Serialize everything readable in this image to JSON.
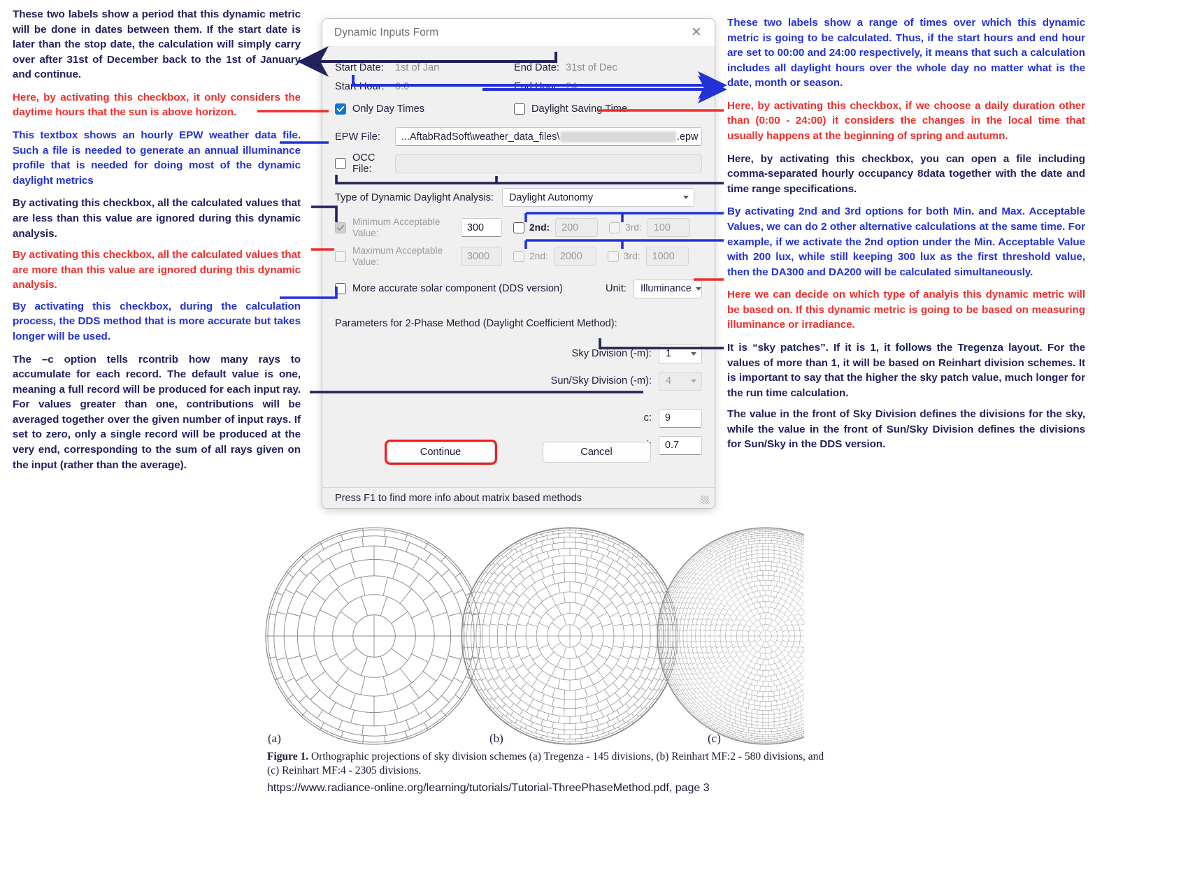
{
  "dialog": {
    "title": "Dynamic Inputs Form",
    "close_icon": "close-icon",
    "start_date_label": "Start Date:",
    "start_date_value": "1st of Jan",
    "end_date_label": "End Date:",
    "end_date_value": "31st of Dec",
    "start_hour_label": "Start Hour:",
    "start_hour_value": "0.0",
    "end_hour_label": "End Hour:",
    "end_hour_value": "24",
    "only_day_times_label": "Only Day Times",
    "daylight_saving_label": "Daylight Saving Time",
    "epw_label": "EPW File:",
    "epw_value_prefix": "...AftabRadSoft\\weather_data_files\\",
    "epw_value_redacted": "SWE_Stockholm_Arlanda",
    "epw_value_suffix": ".epw",
    "occ_label": "OCC File:",
    "occ_value": "",
    "analysis_type_label": "Type of Dynamic Daylight Analysis:",
    "analysis_type_value": "Daylight Autonomy",
    "min_acceptable_label": "Minimum Acceptable Value:",
    "min_value": "300",
    "min_2nd_label": "2nd:",
    "min_2nd_value": "200",
    "min_3rd_label": "3rd:",
    "min_3rd_value": "100",
    "max_acceptable_label": "Maximum Acceptable Value:",
    "max_value": "3000",
    "max_2nd_label": "2nd:",
    "max_2nd_value": "2000",
    "max_3rd_label": "3rd:",
    "max_3rd_value": "1000",
    "dds_label": "More accurate solar component (DDS version)",
    "unit_label": "Unit:",
    "unit_value": "Illuminance",
    "params_header": "Parameters for 2-Phase Method (Daylight Coefficient Method):",
    "sky_division_label": "Sky Division (-m):",
    "sky_division_value": "1",
    "sun_sky_division_label": "Sun/Sky Division (-m):",
    "sun_sky_division_value": "4",
    "c_label": "c:",
    "c_value": "9",
    "pj_label": "pj:",
    "pj_value": "0.7",
    "continue_label": "Continue",
    "cancel_label": "Cancel",
    "statusbar_text": "Press F1 to find more info about matrix based methods"
  },
  "annotations_left": [
    {
      "color": "dark",
      "text": "These two labels show a period that this dynamic metric will be done in dates between them. If the start date is later than the stop date, the calculation will simply carry over after 31st of December back to the 1st of January and continue."
    },
    {
      "color": "red",
      "text": "Here, by activating this checkbox, it only considers the daytime hours that the sun is above horizon."
    },
    {
      "color": "blue",
      "text": "This textbox shows an hourly EPW weather data file. Such a file is needed to generate an annual illuminance profile that is needed for doing most of the dynamic daylight metrics"
    },
    {
      "color": "dark",
      "text": "By activating this checkbox, all the calculated values that are less than this value are ignored during this dynamic analysis."
    },
    {
      "color": "red",
      "text": "By activating this checkbox, all the calculated values that are more than this value are ignored during this dynamic analysis."
    },
    {
      "color": "blue",
      "text": "By activating this checkbox, during the calculation process, the DDS method that is more accurate but takes longer will be used."
    },
    {
      "color": "dark",
      "text": "The –c option tells rcontrib how many rays to accumulate for each record. The default value is one, meaning a full record will be produced for each input ray. For values greater than one, contributions will be averaged together over the given number of input rays. If set to zero, only a single record will be produced at the very end, corresponding to the sum of all rays given on the input (rather than the average)."
    }
  ],
  "annotations_right": [
    {
      "color": "blue",
      "text": "These two labels show a range of times over which this dynamic metric is going to be calculated. Thus, if the start hours and end hour are set to 00:00 and 24:00 respectively, it means that such a calculation includes all daylight hours over the whole day no matter what is the date, month or season."
    },
    {
      "color": "red",
      "text": "Here, by activating this checkbox, if we choose a daily duration other than (0:00 - 24:00) it considers the changes in the local time that usually happens at the beginning of spring and autumn."
    },
    {
      "color": "dark",
      "text": "Here, by activating this checkbox, you can open a file including comma-separated hourly occupancy 8data together with the date and time range specifications."
    },
    {
      "color": "blue",
      "text": "By activating 2nd and 3rd options for both Min. and Max. Acceptable Values, we can do 2 other alternative calculations at the same time. For example, if we activate the 2nd option under the Min. Acceptable Value with 200 lux, while still keeping 300 lux as the first threshold value, then the DA300 and DA200 will be calculated simultaneously."
    },
    {
      "color": "red",
      "text": "Here we can decide on which type of analyis this dynamic metric will be based on. If this dynamic metric is going to be based on measuring illuminance or irradiance."
    },
    {
      "color": "dark",
      "text": "It is “sky patches”. If it is 1, it follows the Tregenza layout. For the values of more than 1, it will be based on Reinhart division schemes. It is important to say that the higher the sky patch value, much longer for the run time calculation."
    },
    {
      "color": "dark",
      "text": "The value in the front of Sky Division defines the divisions for the sky, while the value in the front of Sun/Sky Division defines the divisions for Sun/Sky in the DDS version."
    }
  ],
  "figure": {
    "labels": [
      "(a)",
      "(b)",
      "(c)"
    ],
    "caption_bold": "Figure 1.",
    "caption_text": " Orthographic projections of sky division schemes (a) Tregenza - 145 divisions, (b) Reinhart MF:2 - 580 divisions, and (c) Reinhart MF:4 - 2305 divisions.",
    "url": "https://www.radiance-online.org/learning/tutorials/Tutorial-ThreePhaseMethod.pdf, page 3",
    "diagrams": [
      {
        "name": "tregenza-145",
        "rings": 8,
        "base_sectors": 30
      },
      {
        "name": "reinhart-mf2-580",
        "rings": 15,
        "base_sectors": 60
      },
      {
        "name": "reinhart-mf4-2305",
        "rings": 29,
        "base_sectors": 120
      }
    ]
  },
  "colors": {
    "dark_navy": "#21215e",
    "blue": "#2332d6",
    "red": "#ef2f2b",
    "accent_checkbox": "#1275d6",
    "highlight_outline": "#f81a1a"
  }
}
